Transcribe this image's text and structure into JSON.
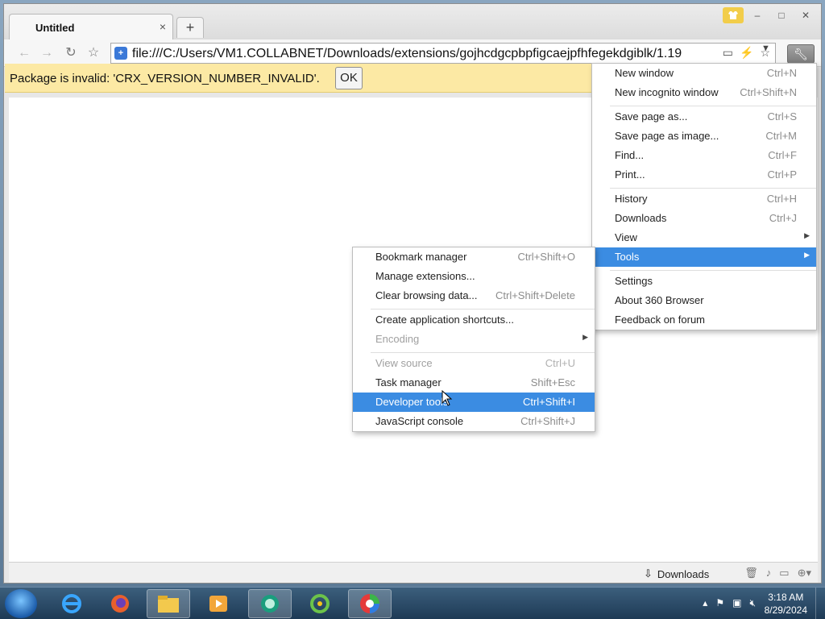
{
  "tab": {
    "title": "Untitled",
    "close": "×",
    "new_tab": "+"
  },
  "window_controls": {
    "skin": "skin-icon",
    "minimize": "–",
    "maximize": "□",
    "close": "✕"
  },
  "toolbar": {
    "url": "file:///C:/Users/VM1.COLLABNET/Downloads/extensions/gojhcdgcpbpfigcaejpfhfegekdgiblk/1.19"
  },
  "infobar": {
    "message": "Package is invalid: 'CRX_VERSION_NUMBER_INVALID'.",
    "ok_label": "OK",
    "background": "#fce9a4"
  },
  "main_menu": {
    "new_window": {
      "label": "New window",
      "shortcut": "Ctrl+N"
    },
    "new_incognito": {
      "label": "New incognito window",
      "shortcut": "Ctrl+Shift+N"
    },
    "save_page_as": {
      "label": "Save page as...",
      "shortcut": "Ctrl+S"
    },
    "save_page_image": {
      "label": "Save page as image...",
      "shortcut": "Ctrl+M"
    },
    "find": {
      "label": "Find...",
      "shortcut": "Ctrl+F"
    },
    "print": {
      "label": "Print...",
      "shortcut": "Ctrl+P"
    },
    "history": {
      "label": "History",
      "shortcut": "Ctrl+H"
    },
    "downloads": {
      "label": "Downloads",
      "shortcut": "Ctrl+J"
    },
    "view": {
      "label": "View"
    },
    "tools": {
      "label": "Tools"
    },
    "settings": {
      "label": "Settings"
    },
    "about": {
      "label": "About 360 Browser"
    },
    "feedback": {
      "label": "Feedback on forum"
    }
  },
  "tools_menu": {
    "bookmark_manager": {
      "label": "Bookmark manager",
      "shortcut": "Ctrl+Shift+O"
    },
    "manage_extensions": {
      "label": "Manage extensions..."
    },
    "clear_browsing": {
      "label": "Clear browsing data...",
      "shortcut": "Ctrl+Shift+Delete"
    },
    "create_shortcuts": {
      "label": "Create application shortcuts..."
    },
    "encoding": {
      "label": "Encoding"
    },
    "view_source": {
      "label": "View source",
      "shortcut": "Ctrl+U"
    },
    "task_manager": {
      "label": "Task manager",
      "shortcut": "Shift+Esc"
    },
    "developer_tools": {
      "label": "Developer tools",
      "shortcut": "Ctrl+Shift+I"
    },
    "javascript_console": {
      "label": "JavaScript console",
      "shortcut": "Ctrl+Shift+J"
    }
  },
  "menu_highlight": "#3b8ce2",
  "statusbar": {
    "downloads_label": "Downloads"
  },
  "taskbar": {
    "apps": [
      "internet-explorer-icon",
      "firefox-icon",
      "file-explorer-icon",
      "media-player-icon",
      "teamviewer-icon",
      "360-safe-icon",
      "360-browser-icon"
    ],
    "time": "3:18 AM",
    "date": "8/29/2024"
  }
}
